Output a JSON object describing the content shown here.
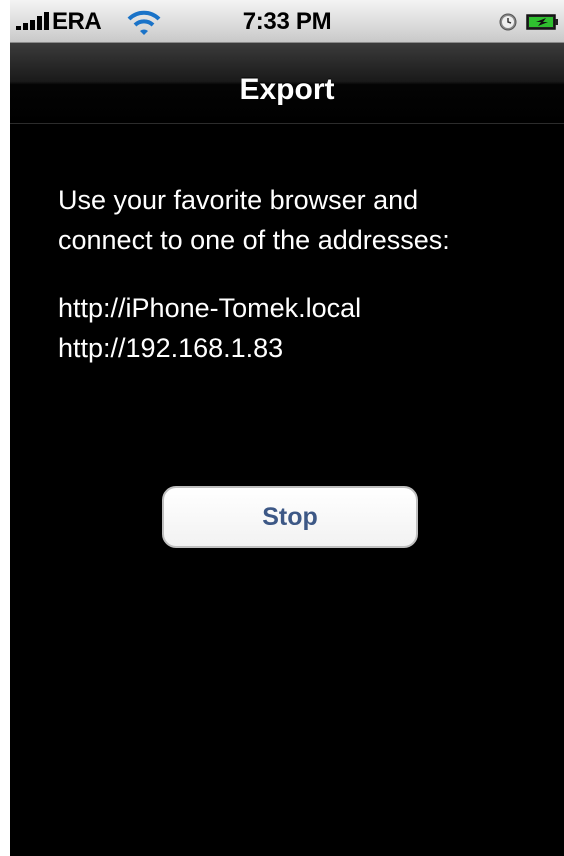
{
  "status_bar": {
    "carrier": "ERA",
    "time": "7:33 PM",
    "icons": [
      "signal-bars-icon",
      "wifi-icon",
      "alarm-icon",
      "battery-charging-icon"
    ]
  },
  "nav_bar": {
    "title": "Export"
  },
  "content": {
    "instruction_line1": "Use your favorite browser and",
    "instruction_line2": "connect to one of the addresses:",
    "addresses": [
      "http://iPhone-Tomek.local",
      "http://192.168.1.83"
    ]
  },
  "actions": {
    "stop_label": "Stop"
  },
  "colors": {
    "background": "#000000",
    "button_text": "#3d5886",
    "status_bar": "#dcdcdc"
  }
}
